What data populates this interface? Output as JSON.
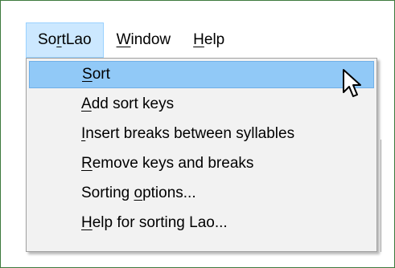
{
  "menubar": {
    "items": [
      {
        "prefix": "So",
        "mnemonic": "r",
        "suffix": "tLao"
      },
      {
        "prefix": "",
        "mnemonic": "W",
        "suffix": "indow"
      },
      {
        "prefix": "",
        "mnemonic": "H",
        "suffix": "elp"
      }
    ]
  },
  "dropdown": {
    "items": [
      {
        "prefix": "",
        "mnemonic": "S",
        "suffix": "ort"
      },
      {
        "prefix": "",
        "mnemonic": "A",
        "suffix": "dd sort keys"
      },
      {
        "prefix": "",
        "mnemonic": "I",
        "suffix": "nsert breaks between syllables"
      },
      {
        "prefix": "",
        "mnemonic": "R",
        "suffix": "emove keys and breaks"
      },
      {
        "prefix": "Sorting ",
        "mnemonic": "o",
        "suffix": "ptions..."
      },
      {
        "prefix": "",
        "mnemonic": "H",
        "suffix": "elp for sorting Lao..."
      }
    ]
  },
  "colors": {
    "menubar_active_bg": "#cce8ff",
    "item_highlight_bg": "#91c9f7",
    "dropdown_bg": "#f2f2f2"
  },
  "icons": {
    "pointer": "arrow-cursor-icon"
  }
}
